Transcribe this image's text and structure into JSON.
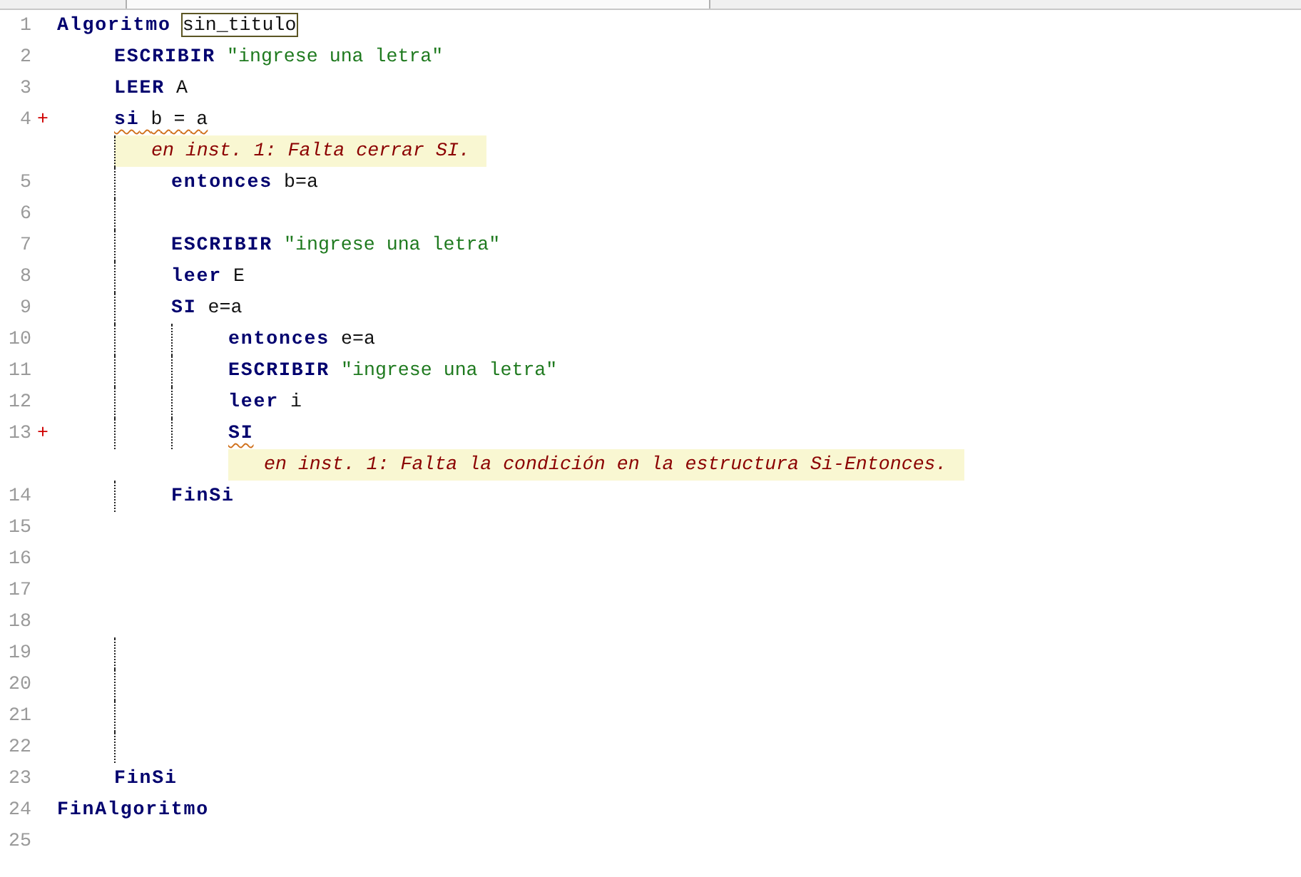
{
  "editor": {
    "lines": [
      {
        "number": "1",
        "tokens": [
          {
            "kind": "keyword",
            "text": "Algoritmo"
          },
          {
            "kind": "name",
            "text": "sin_titulo"
          }
        ],
        "children": [
          {
            "number": "2",
            "tokens": [
              {
                "kind": "keyword",
                "text": "ESCRIBIR"
              },
              {
                "kind": "string",
                "text": "\"ingrese una letra\""
              }
            ],
            "guides": [
              false
            ]
          },
          {
            "number": "3",
            "tokens": [
              {
                "kind": "keyword",
                "text": "LEER"
              },
              {
                "kind": "plain",
                "text": "A"
              }
            ],
            "guides": [
              false
            ]
          },
          {
            "number": "4",
            "fold": "+",
            "tokens": [
              {
                "kind": "keyword",
                "text": "si",
                "underlined": true
              },
              {
                "kind": "plain",
                "text": "b = a",
                "underlined": true
              }
            ],
            "guides": [
              false
            ],
            "error": {
              "text": "en inst. 1: Falta cerrar SI.",
              "guides": [
                false,
                true
              ]
            },
            "children": [
              {
                "number": "5",
                "tokens": [
                  {
                    "kind": "keyword",
                    "text": "entonces"
                  },
                  {
                    "kind": "plain",
                    "text": "b=a"
                  }
                ],
                "guides": [
                  false,
                  true
                ]
              },
              {
                "number": "6",
                "guides": [
                  false,
                  true
                ]
              },
              {
                "number": "7",
                "tokens": [
                  {
                    "kind": "keyword",
                    "text": "ESCRIBIR"
                  },
                  {
                    "kind": "string",
                    "text": "\"ingrese una letra\""
                  }
                ],
                "guides": [
                  false,
                  true
                ]
              },
              {
                "number": "8",
                "tokens": [
                  {
                    "kind": "keyword",
                    "text": "leer"
                  },
                  {
                    "kind": "plain",
                    "text": "E"
                  }
                ],
                "guides": [
                  false,
                  true
                ]
              },
              {
                "number": "9",
                "tokens": [
                  {
                    "kind": "keyword",
                    "text": "SI"
                  },
                  {
                    "kind": "plain",
                    "text": "e=a"
                  }
                ],
                "guides": [
                  false,
                  true
                ],
                "children": [
                  {
                    "number": "10",
                    "tokens": [
                      {
                        "kind": "keyword",
                        "text": "entonces"
                      },
                      {
                        "kind": "plain",
                        "text": "e=a"
                      }
                    ],
                    "guides": [
                      false,
                      true,
                      true
                    ]
                  },
                  {
                    "number": "11",
                    "tokens": [
                      {
                        "kind": "keyword",
                        "text": "ESCRIBIR"
                      },
                      {
                        "kind": "string",
                        "text": "\"ingrese una letra\""
                      }
                    ],
                    "guides": [
                      false,
                      true,
                      true
                    ]
                  },
                  {
                    "number": "12",
                    "tokens": [
                      {
                        "kind": "keyword",
                        "text": "leer"
                      },
                      {
                        "kind": "plain",
                        "text": "i"
                      }
                    ],
                    "guides": [
                      false,
                      true,
                      true
                    ]
                  },
                  {
                    "number": "13",
                    "fold": "+",
                    "tokens": [
                      {
                        "kind": "keyword",
                        "text": "SI",
                        "underlined": true
                      }
                    ],
                    "guides": [
                      false,
                      true,
                      true
                    ],
                    "error": {
                      "text": "en inst. 1: Falta la condición en la estructura Si-Entonces.",
                      "guides": [
                        false,
                        false,
                        false,
                        false
                      ]
                    }
                  }
                ]
              },
              {
                "number": "14",
                "tokens": [
                  {
                    "kind": "keyword",
                    "text": "FinSi"
                  }
                ],
                "guides": [
                  false,
                  true
                ]
              },
              {
                "number": "15",
                "guides": [
                  false,
                  false
                ]
              },
              {
                "number": "16",
                "guides": [
                  false,
                  false
                ]
              },
              {
                "number": "17",
                "guides": [
                  false,
                  false
                ]
              },
              {
                "number": "18",
                "guides": [
                  false,
                  false
                ]
              },
              {
                "number": "19",
                "guides": [
                  false,
                  true
                ]
              },
              {
                "number": "20",
                "guides": [
                  false,
                  true
                ]
              },
              {
                "number": "21",
                "guides": [
                  false,
                  true
                ]
              },
              {
                "number": "22",
                "guides": [
                  false,
                  true
                ]
              }
            ]
          },
          {
            "number": "23",
            "tokens": [
              {
                "kind": "keyword",
                "text": "FinSi"
              }
            ],
            "guides": [
              false
            ]
          }
        ]
      },
      {
        "number": "24",
        "tokens": [
          {
            "kind": "keyword",
            "text": "FinAlgoritmo"
          }
        ]
      },
      {
        "number": "25"
      }
    ]
  }
}
